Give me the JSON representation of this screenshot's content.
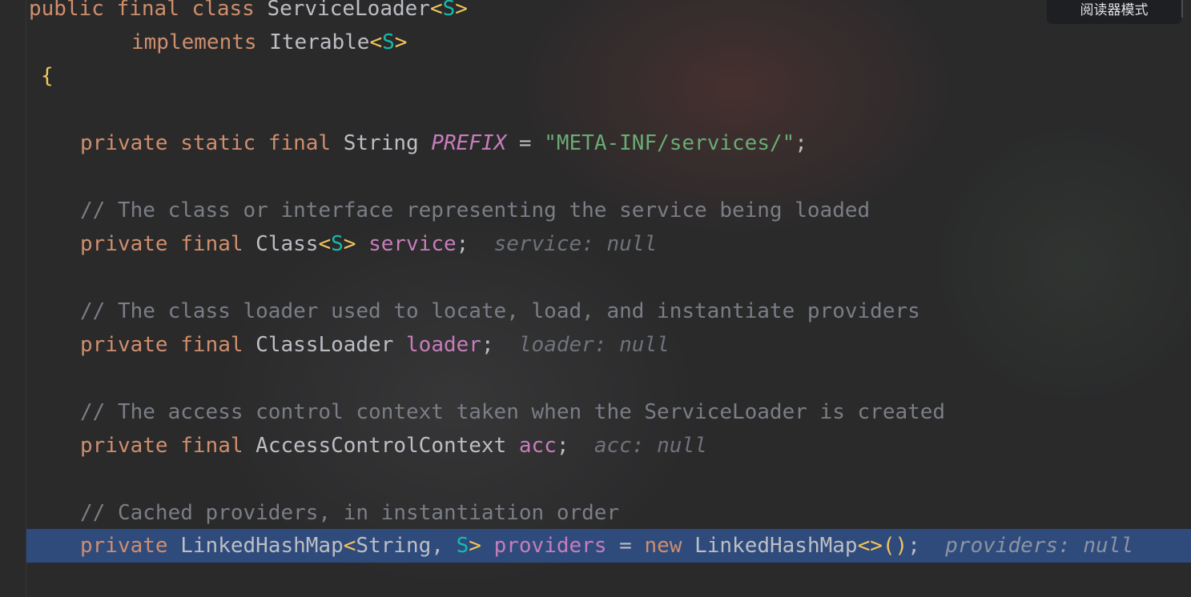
{
  "toolbar": {
    "reader_mode_label": "阅读器模式"
  },
  "code": {
    "line1": {
      "public": "public",
      "final": "final",
      "class": "class",
      "name": "ServiceLoader",
      "lt": "<",
      "tp": "S",
      "gt": ">"
    },
    "line2": {
      "implements": "implements",
      "iface": "Iterable",
      "lt": "<",
      "tp": "S",
      "gt": ">"
    },
    "line3": {
      "brace": "{"
    },
    "prefix_line": {
      "private": "private",
      "static": "static",
      "final": "final",
      "type": "String",
      "name": "PREFIX",
      "eq": " = ",
      "value": "\"META-INF/services/\"",
      "semi": ";"
    },
    "comment_service": "// The class or interface representing the service being loaded",
    "service_line": {
      "private": "private",
      "final": "final",
      "type": "Class",
      "lt": "<",
      "tp": "S",
      "gt": ">",
      "name": "service",
      "semi": ";",
      "hint": "service: null"
    },
    "comment_loader": "// The class loader used to locate, load, and instantiate providers",
    "loader_line": {
      "private": "private",
      "final": "final",
      "type": "ClassLoader",
      "name": "loader",
      "semi": ";",
      "hint": "loader: null"
    },
    "comment_acc": "// The access control context taken when the ServiceLoader is created",
    "acc_line": {
      "private": "private",
      "final": "final",
      "type": "AccessControlContext",
      "name": "acc",
      "semi": ";",
      "hint": "acc: null"
    },
    "comment_providers": "// Cached providers, in instantiation order",
    "providers_line": {
      "private": "private",
      "type": "LinkedHashMap",
      "lt": "<",
      "type2": "String",
      "comma": ", ",
      "tp": "S",
      "gt": ">",
      "name": "providers",
      "eq": " = ",
      "new": "new",
      "ctor": "LinkedHashMap",
      "diamond": "<>",
      "parens": "()",
      "semi": ";",
      "hint": "providers: null"
    }
  },
  "colors": {
    "keyword": "#cf8e6d",
    "type_param": "#16baac",
    "field": "#c77dbb",
    "string": "#6aab73",
    "comment": "#7a7e85",
    "selection": "#2f4b7c",
    "background": "#2a2a2b"
  }
}
